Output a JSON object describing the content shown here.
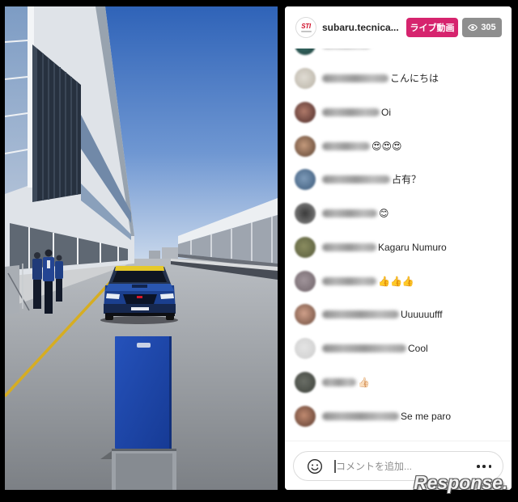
{
  "header": {
    "avatar_logo_text": "STI",
    "username": "subaru.tecnica...",
    "live_label": "ライブ動画",
    "viewer_icon": "eye-icon",
    "viewer_count": "305"
  },
  "comments": [
    {
      "text": "こんにちは"
    },
    {
      "text": "Oi"
    },
    {
      "text": "😍😍😍"
    },
    {
      "text": "占有？"
    },
    {
      "text": "😊"
    },
    {
      "text": "Kagaru Numuro"
    },
    {
      "text": "👍👍👍"
    },
    {
      "text": "Uuuuuufff"
    },
    {
      "text": "Cool"
    },
    {
      "text": "👍🏻"
    },
    {
      "text": "Se me paro"
    }
  ],
  "composer": {
    "emoji_icon": "smiley-icon",
    "placeholder": "コメントを追加...",
    "more_icon": "more-options-icon"
  },
  "watermark": "Response.",
  "colors": {
    "live_badge": "#d6246e",
    "viewer_badge": "#8e8e8e",
    "text": "#262626"
  }
}
